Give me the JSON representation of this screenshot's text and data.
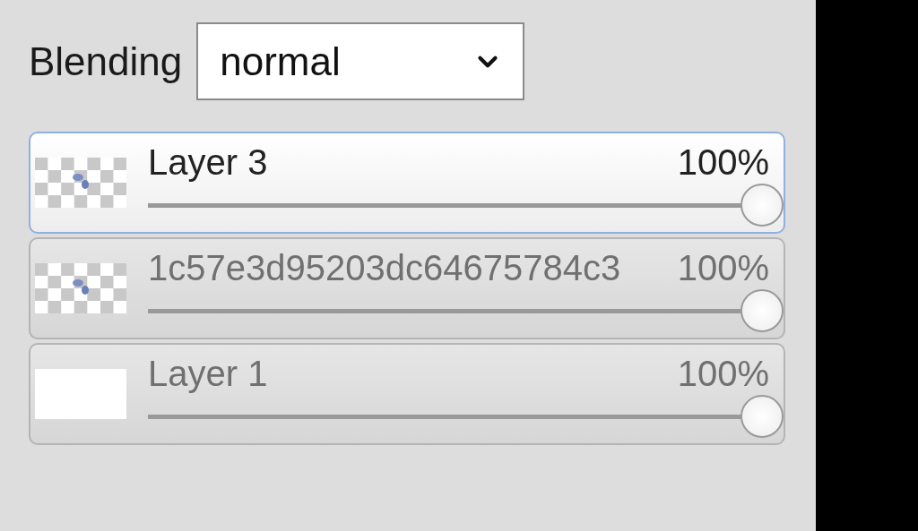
{
  "blending": {
    "label": "Blending",
    "value": "normal"
  },
  "layers": [
    {
      "name": "Layer 3",
      "opacity": "100%",
      "level": 1,
      "selected": true,
      "kind": "transparent"
    },
    {
      "name": "1c57e3d95203dc64675784c3",
      "opacity": "100%",
      "level": 1,
      "selected": false,
      "kind": "transparent"
    },
    {
      "name": "Layer 1",
      "opacity": "100%",
      "level": 1,
      "selected": false,
      "kind": "white"
    }
  ]
}
